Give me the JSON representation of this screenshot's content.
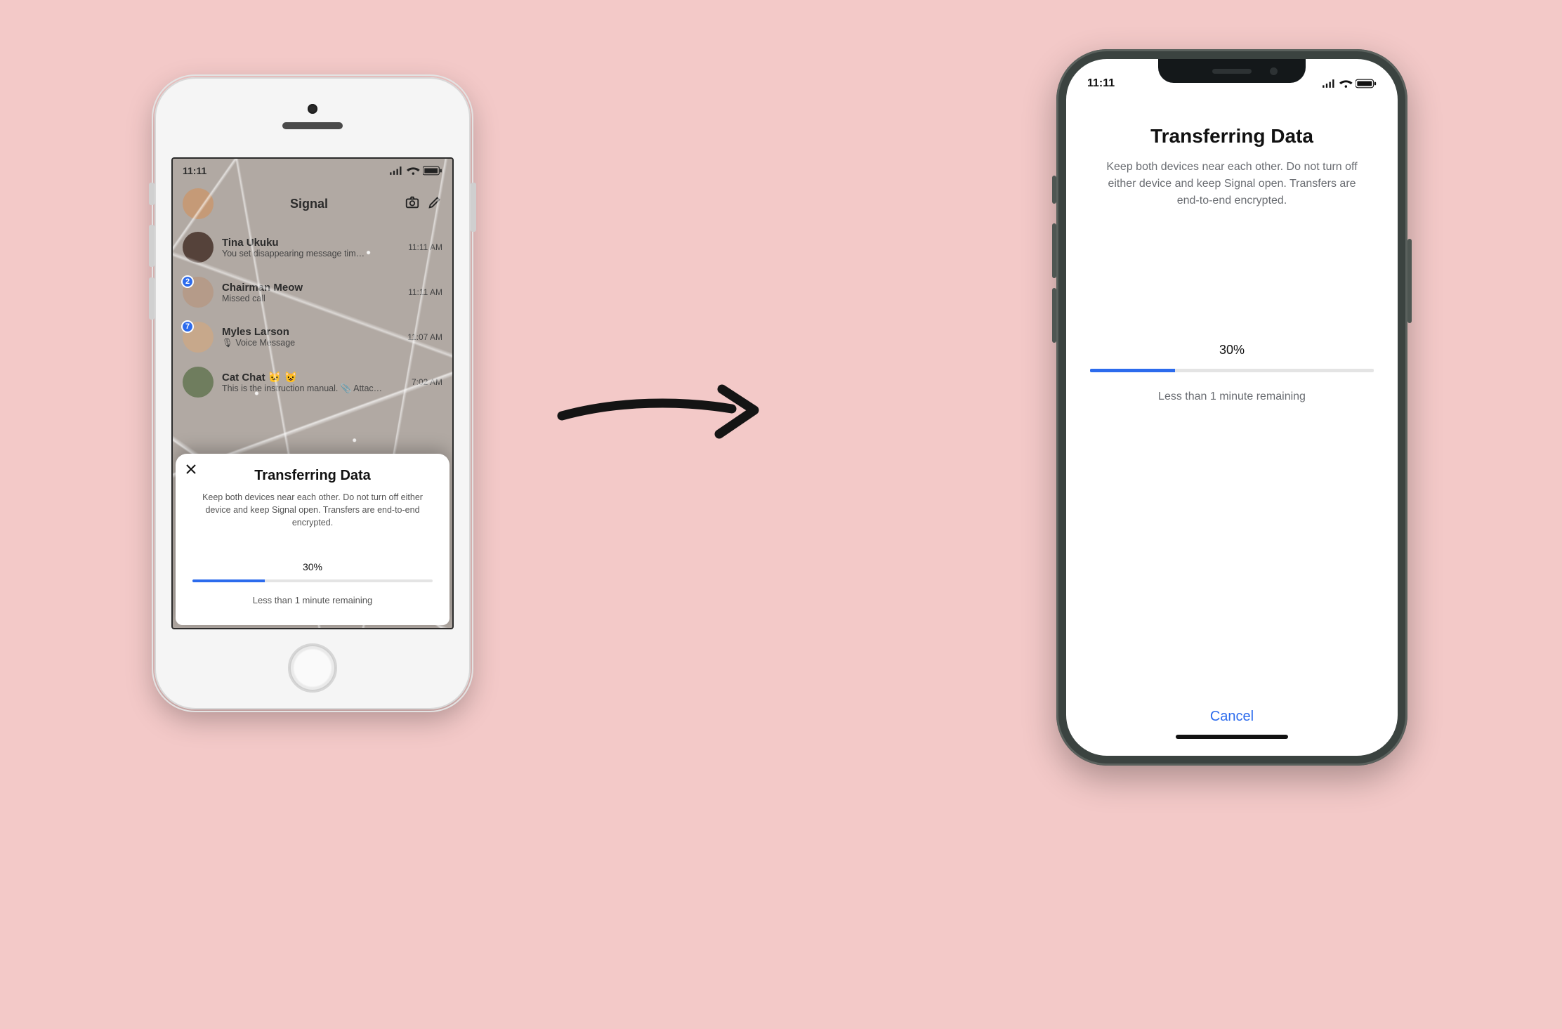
{
  "old_phone": {
    "status_time": "11:11",
    "header": {
      "title": "Signal",
      "camera_icon": "camera-icon",
      "compose_icon": "compose-icon"
    },
    "chats": [
      {
        "name": "Tina Ukuku",
        "sub": "You set disappearing message tim…",
        "time": "11:11 AM",
        "badge": null,
        "avatar_bg": "#55423a"
      },
      {
        "name": "Chairman Meow",
        "sub": "Missed call",
        "time": "11:11 AM",
        "badge": "2",
        "avatar_bg": "#b59b89"
      },
      {
        "name": "Myles Larson",
        "sub": "🎙 Voice Message",
        "time": "11:07 AM",
        "badge": "7",
        "avatar_bg": "#c7a88b"
      },
      {
        "name": "Cat Chat 🐱 😺",
        "sub": "This is the instruction manual. 📎 Attac…",
        "time": "7:02 AM",
        "badge": null,
        "avatar_bg": "#6f7d5e"
      }
    ],
    "sheet": {
      "title": "Transferring Data",
      "description": "Keep both devices near each other. Do not turn off either device and keep Signal open. Transfers are end-to-end encrypted.",
      "percent_label": "30%",
      "percent": 30,
      "remaining": "Less than 1 minute remaining"
    }
  },
  "new_phone": {
    "status_time": "11:11",
    "title": "Transferring Data",
    "description": "Keep both devices near each other. Do not turn off either device and keep Signal open. Transfers are end-to-end encrypted.",
    "percent_label": "30%",
    "percent": 30,
    "remaining": "Less than 1 minute remaining",
    "cancel_label": "Cancel"
  },
  "colors": {
    "accent": "#2c6bed"
  }
}
